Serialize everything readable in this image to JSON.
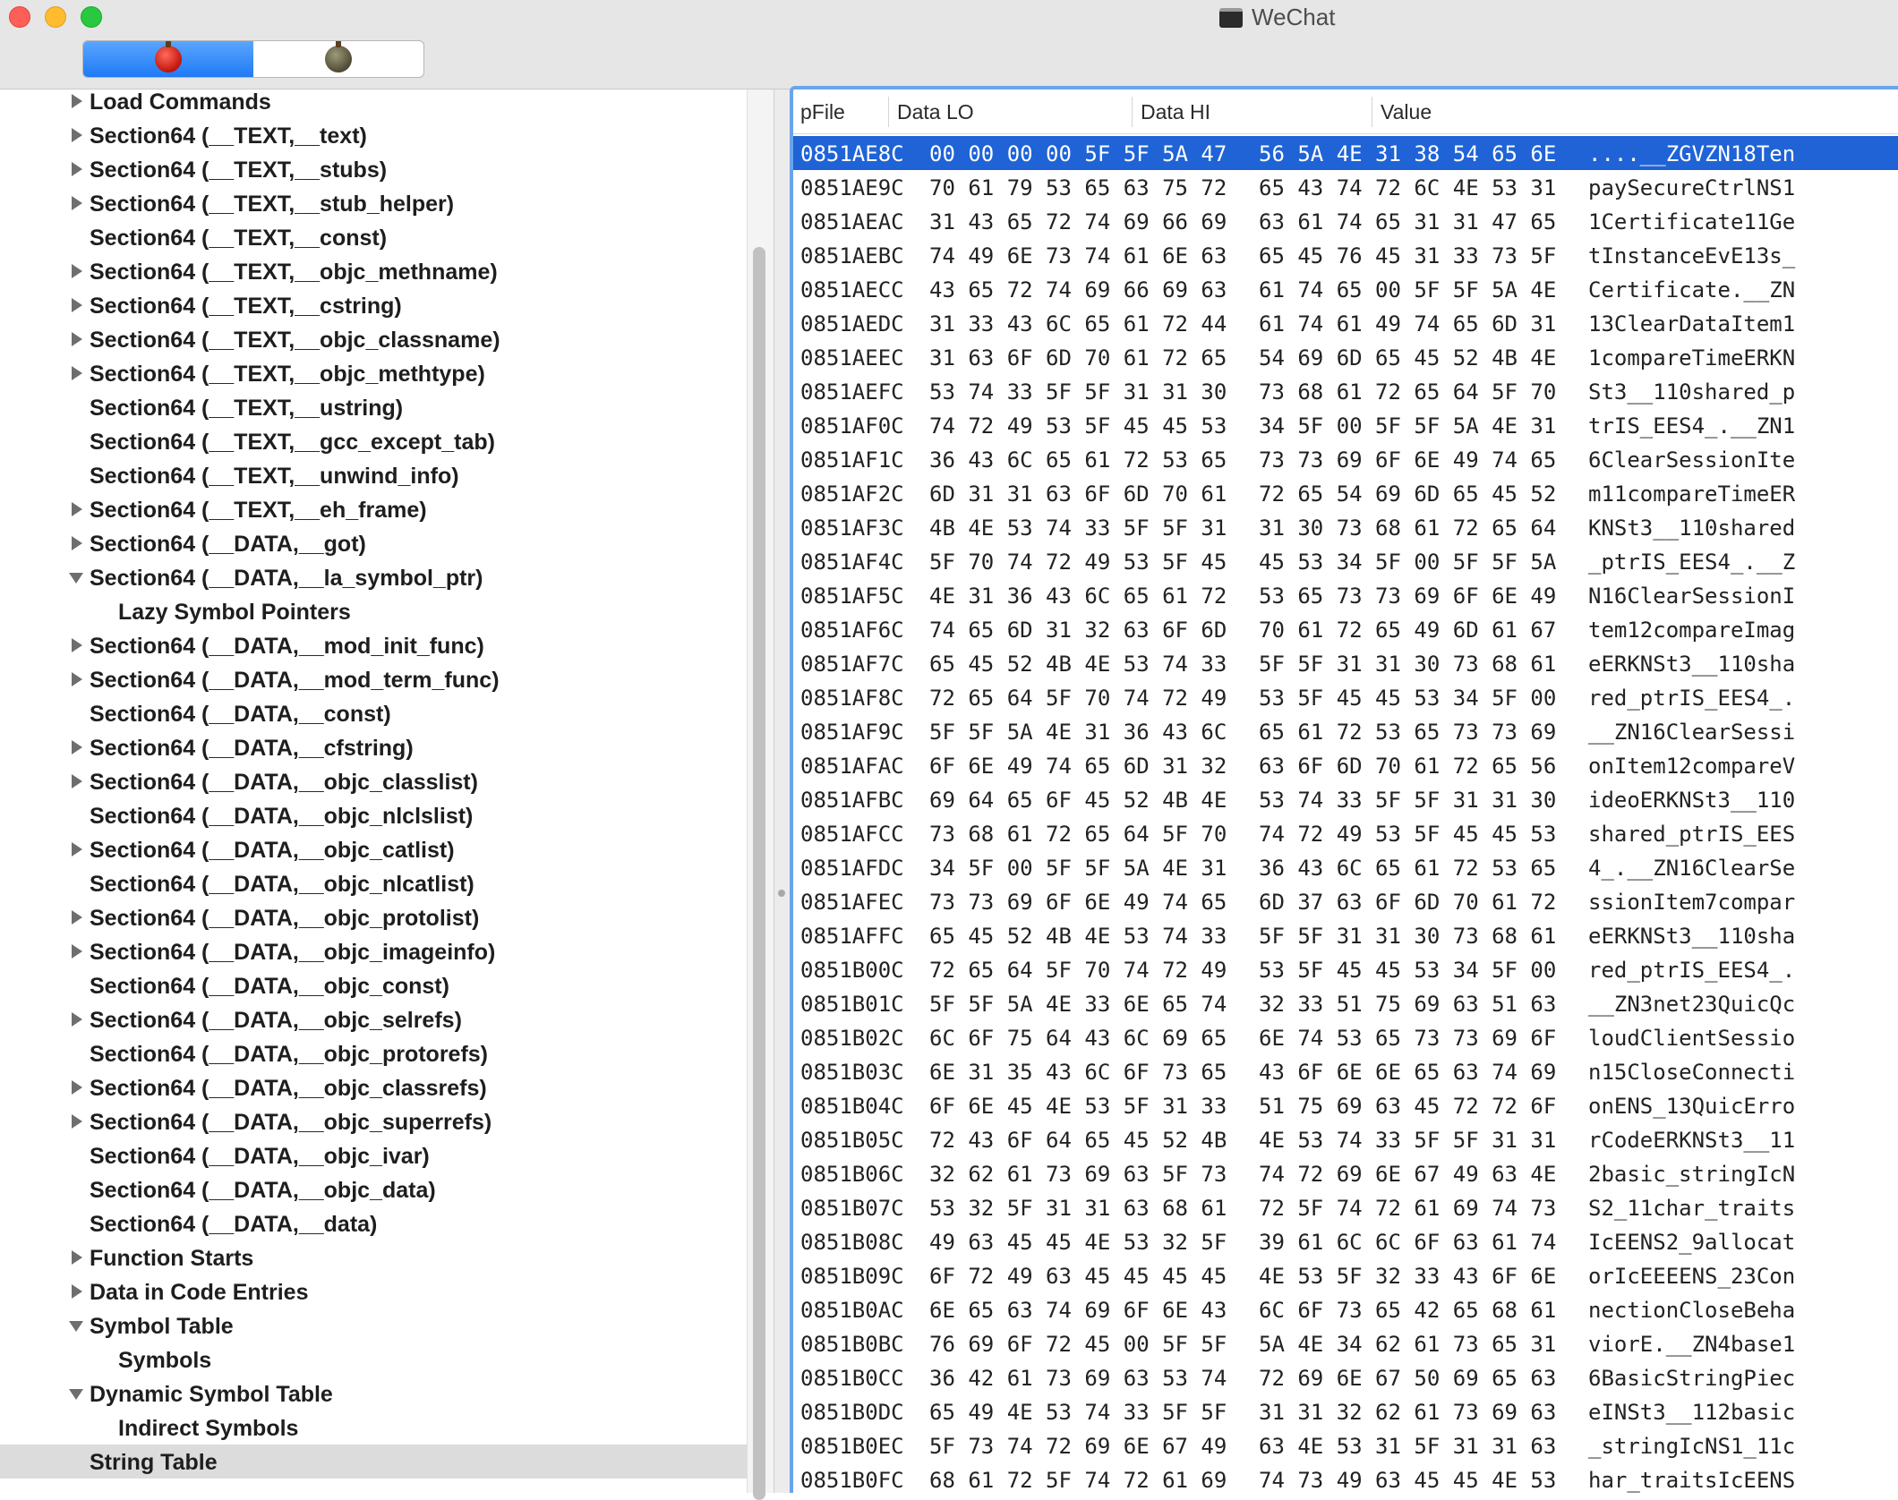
{
  "window": {
    "title": "WeChat",
    "title_icon": "terminal-icon",
    "toolbar": {
      "segments": [
        {
          "icon": "red-apple-bug-icon",
          "active": true
        },
        {
          "icon": "grey-apple-bug-icon",
          "active": false
        }
      ]
    }
  },
  "tree": {
    "items": [
      {
        "label": "Load Commands",
        "level": 0,
        "disclosure": "closed"
      },
      {
        "label": "Section64 (__TEXT,__text)",
        "level": 0,
        "disclosure": "closed"
      },
      {
        "label": "Section64 (__TEXT,__stubs)",
        "level": 0,
        "disclosure": "closed"
      },
      {
        "label": "Section64 (__TEXT,__stub_helper)",
        "level": 0,
        "disclosure": "closed"
      },
      {
        "label": "Section64 (__TEXT,__const)",
        "level": 0,
        "disclosure": "none"
      },
      {
        "label": "Section64 (__TEXT,__objc_methname)",
        "level": 0,
        "disclosure": "closed"
      },
      {
        "label": "Section64 (__TEXT,__cstring)",
        "level": 0,
        "disclosure": "closed"
      },
      {
        "label": "Section64 (__TEXT,__objc_classname)",
        "level": 0,
        "disclosure": "closed"
      },
      {
        "label": "Section64 (__TEXT,__objc_methtype)",
        "level": 0,
        "disclosure": "closed"
      },
      {
        "label": "Section64 (__TEXT,__ustring)",
        "level": 0,
        "disclosure": "none"
      },
      {
        "label": "Section64 (__TEXT,__gcc_except_tab)",
        "level": 0,
        "disclosure": "none"
      },
      {
        "label": "Section64 (__TEXT,__unwind_info)",
        "level": 0,
        "disclosure": "none"
      },
      {
        "label": "Section64 (__TEXT,__eh_frame)",
        "level": 0,
        "disclosure": "closed"
      },
      {
        "label": "Section64 (__DATA,__got)",
        "level": 0,
        "disclosure": "closed"
      },
      {
        "label": "Section64 (__DATA,__la_symbol_ptr)",
        "level": 0,
        "disclosure": "open"
      },
      {
        "label": "Lazy Symbol Pointers",
        "level": 1,
        "disclosure": "none"
      },
      {
        "label": "Section64 (__DATA,__mod_init_func)",
        "level": 0,
        "disclosure": "closed"
      },
      {
        "label": "Section64 (__DATA,__mod_term_func)",
        "level": 0,
        "disclosure": "closed"
      },
      {
        "label": "Section64 (__DATA,__const)",
        "level": 0,
        "disclosure": "none"
      },
      {
        "label": "Section64 (__DATA,__cfstring)",
        "level": 0,
        "disclosure": "closed"
      },
      {
        "label": "Section64 (__DATA,__objc_classlist)",
        "level": 0,
        "disclosure": "closed"
      },
      {
        "label": "Section64 (__DATA,__objc_nlclslist)",
        "level": 0,
        "disclosure": "none"
      },
      {
        "label": "Section64 (__DATA,__objc_catlist)",
        "level": 0,
        "disclosure": "closed"
      },
      {
        "label": "Section64 (__DATA,__objc_nlcatlist)",
        "level": 0,
        "disclosure": "none"
      },
      {
        "label": "Section64 (__DATA,__objc_protolist)",
        "level": 0,
        "disclosure": "closed"
      },
      {
        "label": "Section64 (__DATA,__objc_imageinfo)",
        "level": 0,
        "disclosure": "closed"
      },
      {
        "label": "Section64 (__DATA,__objc_const)",
        "level": 0,
        "disclosure": "none"
      },
      {
        "label": "Section64 (__DATA,__objc_selrefs)",
        "level": 0,
        "disclosure": "closed"
      },
      {
        "label": "Section64 (__DATA,__objc_protorefs)",
        "level": 0,
        "disclosure": "none"
      },
      {
        "label": "Section64 (__DATA,__objc_classrefs)",
        "level": 0,
        "disclosure": "closed"
      },
      {
        "label": "Section64 (__DATA,__objc_superrefs)",
        "level": 0,
        "disclosure": "closed"
      },
      {
        "label": "Section64 (__DATA,__objc_ivar)",
        "level": 0,
        "disclosure": "none"
      },
      {
        "label": "Section64 (__DATA,__objc_data)",
        "level": 0,
        "disclosure": "none"
      },
      {
        "label": "Section64 (__DATA,__data)",
        "level": 0,
        "disclosure": "none"
      },
      {
        "label": "Function Starts",
        "level": 0,
        "disclosure": "closed"
      },
      {
        "label": "Data in Code Entries",
        "level": 0,
        "disclosure": "closed"
      },
      {
        "label": "Symbol Table",
        "level": 0,
        "disclosure": "open"
      },
      {
        "label": "Symbols",
        "level": 1,
        "disclosure": "none"
      },
      {
        "label": "Dynamic Symbol Table",
        "level": 0,
        "disclosure": "open"
      },
      {
        "label": "Indirect Symbols",
        "level": 1,
        "disclosure": "none"
      },
      {
        "label": "String Table",
        "level": 0,
        "disclosure": "none",
        "selected": true
      }
    ]
  },
  "table": {
    "columns": [
      "pFile",
      "Data LO",
      "Data HI",
      "Value"
    ],
    "rows": [
      {
        "pfile": "0851AE8C",
        "lo": "00 00 00 00 5F 5F 5A 47",
        "hi": "56 5A 4E 31 38 54 65 6E",
        "value": "....__ZGVZN18Ten",
        "selected": true
      },
      {
        "pfile": "0851AE9C",
        "lo": "70 61 79 53 65 63 75 72",
        "hi": "65 43 74 72 6C 4E 53 31",
        "value": "paySecureCtrlNS1"
      },
      {
        "pfile": "0851AEAC",
        "lo": "31 43 65 72 74 69 66 69",
        "hi": "63 61 74 65 31 31 47 65",
        "value": "1Certificate11Ge"
      },
      {
        "pfile": "0851AEBC",
        "lo": "74 49 6E 73 74 61 6E 63",
        "hi": "65 45 76 45 31 33 73 5F",
        "value": "tInstanceEvE13s_"
      },
      {
        "pfile": "0851AECC",
        "lo": "43 65 72 74 69 66 69 63",
        "hi": "61 74 65 00 5F 5F 5A 4E",
        "value": "Certificate.__ZN"
      },
      {
        "pfile": "0851AEDC",
        "lo": "31 33 43 6C 65 61 72 44",
        "hi": "61 74 61 49 74 65 6D 31",
        "value": "13ClearDataItem1"
      },
      {
        "pfile": "0851AEEC",
        "lo": "31 63 6F 6D 70 61 72 65",
        "hi": "54 69 6D 65 45 52 4B 4E",
        "value": "1compareTimeERKN"
      },
      {
        "pfile": "0851AEFC",
        "lo": "53 74 33 5F 5F 31 31 30",
        "hi": "73 68 61 72 65 64 5F 70",
        "value": "St3__110shared_p"
      },
      {
        "pfile": "0851AF0C",
        "lo": "74 72 49 53 5F 45 45 53",
        "hi": "34 5F 00 5F 5F 5A 4E 31",
        "value": "trIS_EES4_.__ZN1"
      },
      {
        "pfile": "0851AF1C",
        "lo": "36 43 6C 65 61 72 53 65",
        "hi": "73 73 69 6F 6E 49 74 65",
        "value": "6ClearSessionIte"
      },
      {
        "pfile": "0851AF2C",
        "lo": "6D 31 31 63 6F 6D 70 61",
        "hi": "72 65 54 69 6D 65 45 52",
        "value": "m11compareTimeER"
      },
      {
        "pfile": "0851AF3C",
        "lo": "4B 4E 53 74 33 5F 5F 31",
        "hi": "31 30 73 68 61 72 65 64",
        "value": "KNSt3__110shared"
      },
      {
        "pfile": "0851AF4C",
        "lo": "5F 70 74 72 49 53 5F 45",
        "hi": "45 53 34 5F 00 5F 5F 5A",
        "value": "_ptrIS_EES4_.__Z"
      },
      {
        "pfile": "0851AF5C",
        "lo": "4E 31 36 43 6C 65 61 72",
        "hi": "53 65 73 73 69 6F 6E 49",
        "value": "N16ClearSessionI"
      },
      {
        "pfile": "0851AF6C",
        "lo": "74 65 6D 31 32 63 6F 6D",
        "hi": "70 61 72 65 49 6D 61 67",
        "value": "tem12compareImag"
      },
      {
        "pfile": "0851AF7C",
        "lo": "65 45 52 4B 4E 53 74 33",
        "hi": "5F 5F 31 31 30 73 68 61",
        "value": "eERKNSt3__110sha"
      },
      {
        "pfile": "0851AF8C",
        "lo": "72 65 64 5F 70 74 72 49",
        "hi": "53 5F 45 45 53 34 5F 00",
        "value": "red_ptrIS_EES4_."
      },
      {
        "pfile": "0851AF9C",
        "lo": "5F 5F 5A 4E 31 36 43 6C",
        "hi": "65 61 72 53 65 73 73 69",
        "value": "__ZN16ClearSessi"
      },
      {
        "pfile": "0851AFAC",
        "lo": "6F 6E 49 74 65 6D 31 32",
        "hi": "63 6F 6D 70 61 72 65 56",
        "value": "onItem12compareV"
      },
      {
        "pfile": "0851AFBC",
        "lo": "69 64 65 6F 45 52 4B 4E",
        "hi": "53 74 33 5F 5F 31 31 30",
        "value": "ideoERKNSt3__110"
      },
      {
        "pfile": "0851AFCC",
        "lo": "73 68 61 72 65 64 5F 70",
        "hi": "74 72 49 53 5F 45 45 53",
        "value": "shared_ptrIS_EES"
      },
      {
        "pfile": "0851AFDC",
        "lo": "34 5F 00 5F 5F 5A 4E 31",
        "hi": "36 43 6C 65 61 72 53 65",
        "value": "4_.__ZN16ClearSe"
      },
      {
        "pfile": "0851AFEC",
        "lo": "73 73 69 6F 6E 49 74 65",
        "hi": "6D 37 63 6F 6D 70 61 72",
        "value": "ssionItem7compar"
      },
      {
        "pfile": "0851AFFC",
        "lo": "65 45 52 4B 4E 53 74 33",
        "hi": "5F 5F 31 31 30 73 68 61",
        "value": "eERKNSt3__110sha"
      },
      {
        "pfile": "0851B00C",
        "lo": "72 65 64 5F 70 74 72 49",
        "hi": "53 5F 45 45 53 34 5F 00",
        "value": "red_ptrIS_EES4_."
      },
      {
        "pfile": "0851B01C",
        "lo": "5F 5F 5A 4E 33 6E 65 74",
        "hi": "32 33 51 75 69 63 51 63",
        "value": "__ZN3net23QuicQc"
      },
      {
        "pfile": "0851B02C",
        "lo": "6C 6F 75 64 43 6C 69 65",
        "hi": "6E 74 53 65 73 73 69 6F",
        "value": "loudClientSessio"
      },
      {
        "pfile": "0851B03C",
        "lo": "6E 31 35 43 6C 6F 73 65",
        "hi": "43 6F 6E 6E 65 63 74 69",
        "value": "n15CloseConnecti"
      },
      {
        "pfile": "0851B04C",
        "lo": "6F 6E 45 4E 53 5F 31 33",
        "hi": "51 75 69 63 45 72 72 6F",
        "value": "onENS_13QuicErro"
      },
      {
        "pfile": "0851B05C",
        "lo": "72 43 6F 64 65 45 52 4B",
        "hi": "4E 53 74 33 5F 5F 31 31",
        "value": "rCodeERKNSt3__11"
      },
      {
        "pfile": "0851B06C",
        "lo": "32 62 61 73 69 63 5F 73",
        "hi": "74 72 69 6E 67 49 63 4E",
        "value": "2basic_stringIcN"
      },
      {
        "pfile": "0851B07C",
        "lo": "53 32 5F 31 31 63 68 61",
        "hi": "72 5F 74 72 61 69 74 73",
        "value": "S2_11char_traits"
      },
      {
        "pfile": "0851B08C",
        "lo": "49 63 45 45 4E 53 32 5F",
        "hi": "39 61 6C 6C 6F 63 61 74",
        "value": "IcEENS2_9allocat"
      },
      {
        "pfile": "0851B09C",
        "lo": "6F 72 49 63 45 45 45 45",
        "hi": "4E 53 5F 32 33 43 6F 6E",
        "value": "orIcEEEENS_23Con"
      },
      {
        "pfile": "0851B0AC",
        "lo": "6E 65 63 74 69 6F 6E 43",
        "hi": "6C 6F 73 65 42 65 68 61",
        "value": "nectionCloseBeha"
      },
      {
        "pfile": "0851B0BC",
        "lo": "76 69 6F 72 45 00 5F 5F",
        "hi": "5A 4E 34 62 61 73 65 31",
        "value": "viorE.__ZN4base1"
      },
      {
        "pfile": "0851B0CC",
        "lo": "36 42 61 73 69 63 53 74",
        "hi": "72 69 6E 67 50 69 65 63",
        "value": "6BasicStringPiec"
      },
      {
        "pfile": "0851B0DC",
        "lo": "65 49 4E 53 74 33 5F 5F",
        "hi": "31 31 32 62 61 73 69 63",
        "value": "eINSt3__112basic"
      },
      {
        "pfile": "0851B0EC",
        "lo": "5F 73 74 72 69 6E 67 49",
        "hi": "63 4E 53 31 5F 31 31 63",
        "value": "_stringIcNS1_11c"
      },
      {
        "pfile": "0851B0FC",
        "lo": "68 61 72 5F 74 72 61 69",
        "hi": "74 73 49 63 45 45 4E 53",
        "value": "har_traitsIcEENS"
      }
    ]
  }
}
